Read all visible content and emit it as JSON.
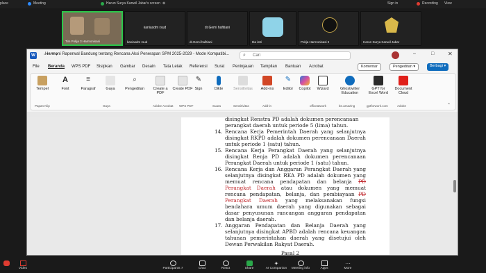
{
  "zoom_topbar": {
    "left_label": "place",
    "meeting_label": "Meeting",
    "share_label": "Harun Surya Kanwil Jabar's screen",
    "signin_label": "Sign in",
    "recording_label": "Recording",
    "view_label": "View"
  },
  "participants": [
    {
      "name": "Tim Pokja 3 Harmonisasi"
    },
    {
      "name": "kaniasdm rsud"
    },
    {
      "name": "dr.Gemi hafitiani"
    },
    {
      "name": "tita istri"
    },
    {
      "name": "Pokja Harmonisasi II"
    },
    {
      "name": "Harun Surya Kanwil Jabar"
    }
  ],
  "word": {
    "title": "Harmoni Raperwal Bandung tentang Rencana Aksi Penerapan SPM 2025-2029  -  Mode Kompatibi...",
    "search_placeholder": "Cari",
    "menu": [
      "File",
      "Beranda",
      "WPS PDF",
      "Sisipkan",
      "Gambar",
      "Desain",
      "Tata Letak",
      "Referensi",
      "Surat",
      "Peninjauan",
      "Tampilan",
      "Bantuan",
      "Acrobat"
    ],
    "komentar_label": "Komentar",
    "pengeditan_label": "Pengeditan",
    "berbagi_label": "Berbagi",
    "ribbon": [
      {
        "label": "Tempel"
      },
      {
        "label": "Font"
      },
      {
        "label": "Paragraf"
      },
      {
        "label": "Gaya"
      },
      {
        "label": "Pengeditan"
      },
      {
        "label": "Create a PDF"
      },
      {
        "label": "Create PDF"
      },
      {
        "label": "Sign"
      },
      {
        "label": "Dikte"
      },
      {
        "label": "Sensitivitas"
      },
      {
        "label": "Add-ins"
      },
      {
        "label": "Editor"
      },
      {
        "label": "Copilot"
      },
      {
        "label": "Wizard"
      },
      {
        "label": "Ghostwriter Education"
      },
      {
        "label": "GPT for Excel Word"
      },
      {
        "label": "Document Cloud"
      }
    ],
    "groups": [
      "Papan Klip",
      "Gaya",
      "Adobe Acrobat",
      "WPS PDF",
      "Suara",
      "Sensitivitas",
      "Add-in",
      "officeatwork",
      "be.amazing",
      "gptforwork.com",
      "Adobe"
    ]
  },
  "document": {
    "intro_line1": "disingkat Renstra PD adalah dokumen perencanaan",
    "intro_line2": "perangkat daerah untuk periode 5 (lima) tahun.",
    "item14_num": "14.",
    "item14": "Rencana Kerja Pemerintah Daerah yang selanjutnya disingkat RKPD adalah dokumen perencanaan Daerah untuk periode 1 (satu) tahun.",
    "item15_num": "15.",
    "item15": "Rencana Kerja Perangkat Daerah yang selanjutnya disingkat Renja PD adalah dokumen perencanaan Perangkat Daerah untuk periode 1 (satu) tahun.",
    "item16_num": "16.",
    "item16_a": "Rencana Kerja dan Anggaran Perangkat Daerah yang selanjutnya disingkat RKA PD adalah dokumen yang memuat rencana pendapatan dan belanja ",
    "item16_strike1": "PD",
    "item16_red1": " Perangkat Daerah",
    "item16_b": " atau dokumen yang memuat rencana pendapatan, belanja, dan pembiayaan ",
    "item16_strike2": "PD",
    "item16_red2": " Perangkat Daerah",
    "item16_c": " yang melaksanakan fungsi bendahara umum daerah yang digunakan sebagai dasar penyusunan rancangan anggaran pendapatan dan belanja daerah.",
    "item17_num": "17.",
    "item17": "Anggaran Pendapatan dan Belanja Daerah yang selanjutnya disingkat APBD adalah rencana keuangan tahunan pemerintahan daerah yang disetujui oleh Dewan Perwakilan Rakyat Daerah.",
    "pasal": "Pasal 2"
  },
  "zoom_bottombar": [
    {
      "label": "Video"
    },
    {
      "label": "Participants"
    },
    {
      "label": "Chat"
    },
    {
      "label": "React"
    },
    {
      "label": "Share"
    },
    {
      "label": "AI Companion"
    },
    {
      "label": "Meeting info"
    },
    {
      "label": "Apps"
    },
    {
      "label": "More"
    }
  ],
  "participants_count": "7",
  "colors": {
    "accent": "#0f6cbd",
    "record": "#e03c31",
    "share": "#2aa84a",
    "red_text": "#c0282d"
  }
}
